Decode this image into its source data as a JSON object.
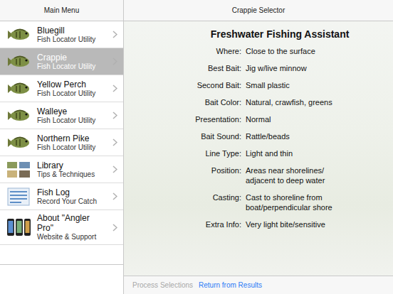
{
  "sidebar": {
    "title": "Main Menu",
    "items": [
      {
        "title": "Bluegill",
        "subtitle": "Fish Locator Utility",
        "selected": false,
        "kind": "fish"
      },
      {
        "title": "Crappie",
        "subtitle": "Fish Locator Utility",
        "selected": true,
        "kind": "fish"
      },
      {
        "title": "Yellow Perch",
        "subtitle": "Fish Locator Utility",
        "selected": false,
        "kind": "fish"
      },
      {
        "title": "Walleye",
        "subtitle": "Fish Locator Utility",
        "selected": false,
        "kind": "fish"
      },
      {
        "title": "Northern Pike",
        "subtitle": "Fish Locator Utility",
        "selected": false,
        "kind": "fish"
      },
      {
        "title": "Library",
        "subtitle": "Tips & Techniques",
        "selected": false,
        "kind": "library"
      },
      {
        "title": "Fish Log",
        "subtitle": "Record Your Catch",
        "selected": false,
        "kind": "log"
      },
      {
        "title": "About \"Angler Pro\"",
        "subtitle": "Website & Support",
        "selected": false,
        "kind": "about"
      }
    ]
  },
  "detail": {
    "title": "Crappie Selector",
    "heading": "Freshwater Fishing Assistant",
    "fields": [
      {
        "label": "Where:",
        "value": "Close to the surface"
      },
      {
        "label": "Best Bait:",
        "value": "Jig w/live minnow"
      },
      {
        "label": "Second Bait:",
        "value": "Small plastic"
      },
      {
        "label": "Bait Color:",
        "value": "Natural, crawfish, greens"
      },
      {
        "label": "Presentation:",
        "value": "Normal"
      },
      {
        "label": "Bait Sound:",
        "value": "Rattle/beads"
      },
      {
        "label": "Line Type:",
        "value": "Light and thin"
      },
      {
        "label": "Position:",
        "value": "Areas near shorelines/ adjacent to deep water"
      },
      {
        "label": "Casting:",
        "value": "Cast to shoreline from boat/perpendicular shore"
      },
      {
        "label": "Extra Info:",
        "value": "Very light bite/sensitive"
      }
    ]
  },
  "toolbar": {
    "buttons": [
      {
        "label": "Process Selections",
        "disabled": true
      },
      {
        "label": "Return from Results",
        "disabled": false
      }
    ]
  }
}
